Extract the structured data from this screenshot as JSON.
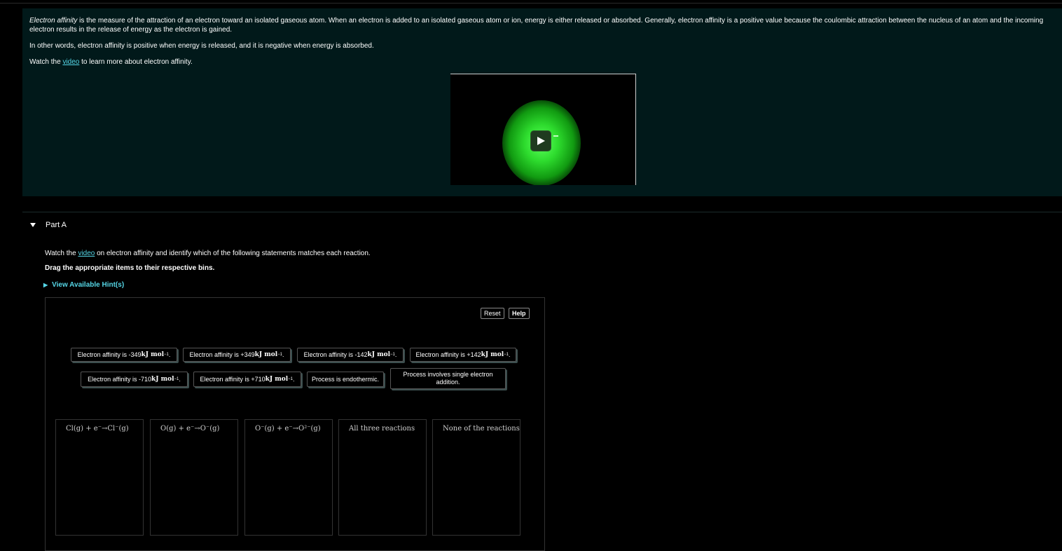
{
  "intro": {
    "term": "Electron affinity",
    "p1_rest": " is the measure of the attraction of an electron toward an isolated gaseous atom. When an electron is added to an isolated gaseous atom or ion, energy is either released or absorbed. Generally, electron affinity is a positive value because the coulombic attraction between the nucleus of an atom and the incoming electron results in the release of energy as the electron is gained.",
    "p2": "In other words, electron affinity is positive when energy is released, and it is negative when energy is absorbed.",
    "p3_before": "Watch the ",
    "p3_link": "video",
    "p3_after": " to learn more about electron affinity.",
    "video_icons": [
      "play-icon",
      "electron-glow"
    ]
  },
  "part": {
    "label": "Part A",
    "q1_before": "Watch the ",
    "q1_link": "video",
    "q1_after": " on electron affinity and identify which of the following statements matches each reaction.",
    "q2": "Drag the appropriate items to their respective bins.",
    "hints_label": "View Available Hint(s)"
  },
  "dnd": {
    "reset_label": "Reset",
    "help_label": "Help",
    "unit": "kJ mol",
    "unit_exp": "−1",
    "chips": [
      {
        "prefix": "Electron affinity is -349 ",
        "has_unit": true
      },
      {
        "prefix": "Electron affinity is +349 ",
        "has_unit": true
      },
      {
        "prefix": "Electron affinity is -142 ",
        "has_unit": true
      },
      {
        "prefix": "Electron affinity is +142 ",
        "has_unit": true
      },
      {
        "prefix": "Electron affinity is -710 ",
        "has_unit": true
      },
      {
        "prefix": "Electron affinity is +710 ",
        "has_unit": true
      },
      {
        "text": "Process is endothermic."
      },
      {
        "text": "Process involves single electron addition."
      }
    ],
    "bins": [
      {
        "label": "Cl(g) + e⁻→Cl⁻(g)"
      },
      {
        "label": "O(g) + e⁻→O⁻(g)"
      },
      {
        "label": "O⁻(g) + e⁻→O²⁻(g)"
      },
      {
        "label": "All three reactions"
      },
      {
        "label": "None of the reactions"
      }
    ]
  },
  "colors": {
    "page_bg": "#000000",
    "intro_bg": "#01191a",
    "link": "#55d6e6",
    "glow": "#2edc2e"
  }
}
